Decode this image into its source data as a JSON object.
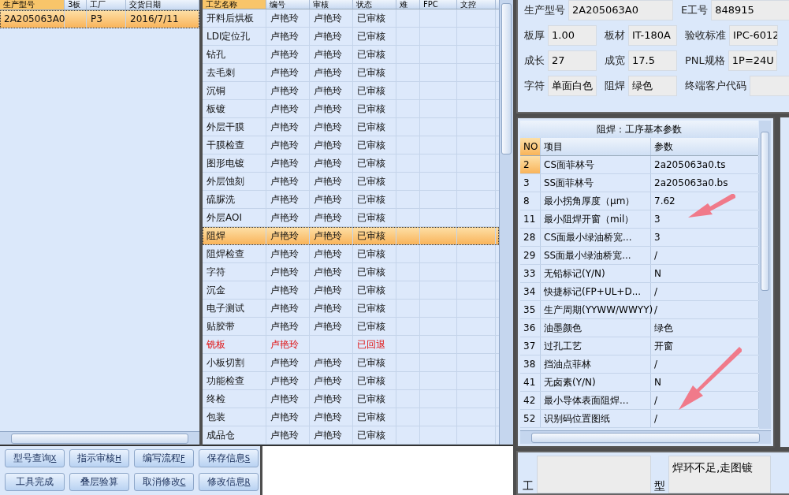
{
  "model_list": {
    "columns": [
      "生产型号",
      "3板",
      "工厂",
      "交货日期"
    ],
    "rows": [
      {
        "cells": [
          "2A205063A0",
          "",
          "P3",
          "2016/7/11"
        ],
        "selected": true
      }
    ]
  },
  "process_table": {
    "columns": [
      "工艺名称",
      "编号",
      "审核",
      "状态",
      "难",
      "FPC",
      "文控"
    ],
    "rows": [
      {
        "cells": [
          "开料后烘板",
          "卢艳玲",
          "卢艳玲",
          "已审核"
        ],
        "selected": false,
        "rejected": false
      },
      {
        "cells": [
          "LDI定位孔",
          "卢艳玲",
          "卢艳玲",
          "已审核"
        ],
        "selected": false,
        "rejected": false
      },
      {
        "cells": [
          "钻孔",
          "卢艳玲",
          "卢艳玲",
          "已审核"
        ],
        "selected": false,
        "rejected": false
      },
      {
        "cells": [
          "去毛刺",
          "卢艳玲",
          "卢艳玲",
          "已审核"
        ],
        "selected": false,
        "rejected": false
      },
      {
        "cells": [
          "沉铜",
          "卢艳玲",
          "卢艳玲",
          "已审核"
        ],
        "selected": false,
        "rejected": false
      },
      {
        "cells": [
          "板镀",
          "卢艳玲",
          "卢艳玲",
          "已审核"
        ],
        "selected": false,
        "rejected": false
      },
      {
        "cells": [
          "外层干膜",
          "卢艳玲",
          "卢艳玲",
          "已审核"
        ],
        "selected": false,
        "rejected": false
      },
      {
        "cells": [
          "干膜检查",
          "卢艳玲",
          "卢艳玲",
          "已审核"
        ],
        "selected": false,
        "rejected": false
      },
      {
        "cells": [
          "图形电镀",
          "卢艳玲",
          "卢艳玲",
          "已审核"
        ],
        "selected": false,
        "rejected": false
      },
      {
        "cells": [
          "外层蚀刻",
          "卢艳玲",
          "卢艳玲",
          "已审核"
        ],
        "selected": false,
        "rejected": false
      },
      {
        "cells": [
          "硫脲洗",
          "卢艳玲",
          "卢艳玲",
          "已审核"
        ],
        "selected": false,
        "rejected": false
      },
      {
        "cells": [
          "外层AOI",
          "卢艳玲",
          "卢艳玲",
          "已审核"
        ],
        "selected": false,
        "rejected": false
      },
      {
        "cells": [
          "阻焊",
          "卢艳玲",
          "卢艳玲",
          "已审核"
        ],
        "selected": true,
        "rejected": false
      },
      {
        "cells": [
          "阻焊检查",
          "卢艳玲",
          "卢艳玲",
          "已审核"
        ],
        "selected": false,
        "rejected": false
      },
      {
        "cells": [
          "字符",
          "卢艳玲",
          "卢艳玲",
          "已审核"
        ],
        "selected": false,
        "rejected": false
      },
      {
        "cells": [
          "沉金",
          "卢艳玲",
          "卢艳玲",
          "已审核"
        ],
        "selected": false,
        "rejected": false
      },
      {
        "cells": [
          "电子测试",
          "卢艳玲",
          "卢艳玲",
          "已审核"
        ],
        "selected": false,
        "rejected": false
      },
      {
        "cells": [
          "贴胶带",
          "卢艳玲",
          "卢艳玲",
          "已审核"
        ],
        "selected": false,
        "rejected": false
      },
      {
        "cells": [
          "铣板",
          "卢艳玲",
          "",
          "已回退"
        ],
        "selected": false,
        "rejected": true
      },
      {
        "cells": [
          "小板切割",
          "卢艳玲",
          "卢艳玲",
          "已审核"
        ],
        "selected": false,
        "rejected": false
      },
      {
        "cells": [
          "功能检查",
          "卢艳玲",
          "卢艳玲",
          "已审核"
        ],
        "selected": false,
        "rejected": false
      },
      {
        "cells": [
          "终检",
          "卢艳玲",
          "卢艳玲",
          "已审核"
        ],
        "selected": false,
        "rejected": false
      },
      {
        "cells": [
          "包装",
          "卢艳玲",
          "卢艳玲",
          "已审核"
        ],
        "selected": false,
        "rejected": false
      },
      {
        "cells": [
          "成品仓",
          "卢艳玲",
          "卢艳玲",
          "已审核"
        ],
        "selected": false,
        "rejected": false
      }
    ]
  },
  "buttons": [
    {
      "label": "型号查询",
      "key": "X"
    },
    {
      "label": "指示审核",
      "key": "H"
    },
    {
      "label": "编写流程",
      "key": "F"
    },
    {
      "label": "保存信息",
      "key": "S"
    },
    {
      "label": "工具完成"
    },
    {
      "label": "叠层验算"
    },
    {
      "label": "取消修改",
      "key": "C"
    },
    {
      "label": "修改信息",
      "key": "R"
    }
  ],
  "info_form": [
    [
      {
        "label": "生产型号",
        "value": "2A205063A0"
      },
      {
        "label": "E工号",
        "value": "848915"
      }
    ],
    [
      {
        "label": "板厚",
        "value": "1.00"
      },
      {
        "label": "板材",
        "value": "IT-180A"
      },
      {
        "label": "验收标准",
        "value": "IPC-6012"
      }
    ],
    [
      {
        "label": "成长",
        "value": "27"
      },
      {
        "label": "成宽",
        "value": "17.5"
      },
      {
        "label": "PNL规格",
        "value": "1P=24U"
      }
    ],
    [
      {
        "label": "字符",
        "value": "单面白色"
      },
      {
        "label": "阻焊",
        "value": "绿色"
      },
      {
        "label": "终端客户代码"
      }
    ]
  ],
  "params": {
    "title": "阻焊：工序基本参数",
    "columns": [
      "NO",
      "项目",
      "参数"
    ],
    "rows": [
      {
        "no": "2",
        "item": "CS面菲林号",
        "value": "2a205063a0.ts",
        "selected": true
      },
      {
        "no": "3",
        "item": "SS面菲林号",
        "value": "2a205063a0.bs",
        "selected": false
      },
      {
        "no": "8",
        "item": "最小拐角厚度（μm）",
        "value": "7.62",
        "selected": false
      },
      {
        "no": "11",
        "item": "最小阻焊开窗（mil）",
        "value": "3",
        "selected": false
      },
      {
        "no": "28",
        "item": "CS面最小绿油桥宽...",
        "value": "3",
        "selected": false
      },
      {
        "no": "29",
        "item": "SS面最小绿油桥宽...",
        "value": "/",
        "selected": false
      },
      {
        "no": "33",
        "item": "无铅标记(Y/N)",
        "value": "N",
        "selected": false
      },
      {
        "no": "34",
        "item": "快捷标记(FP+UL+D...",
        "value": "/",
        "selected": false
      },
      {
        "no": "35",
        "item": "生产周期(YYWW/WWYY)",
        "value": "/",
        "selected": false
      },
      {
        "no": "36",
        "item": "油墨颜色",
        "value": "绿色",
        "selected": false
      },
      {
        "no": "37",
        "item": "过孔工艺",
        "value": "开窗",
        "selected": false
      },
      {
        "no": "38",
        "item": "挡油点菲林",
        "value": "/",
        "selected": false
      },
      {
        "no": "41",
        "item": "无卤素(Y/N)",
        "value": "N",
        "selected": false
      },
      {
        "no": "42",
        "item": "最小导体表面阻焊...",
        "value": "/",
        "selected": false
      },
      {
        "no": "52",
        "item": "识别码位置图纸",
        "value": "/",
        "selected": false
      }
    ]
  },
  "notes": {
    "label_1": "工",
    "label_2": "型",
    "text": "焊环不足,走图镀"
  }
}
